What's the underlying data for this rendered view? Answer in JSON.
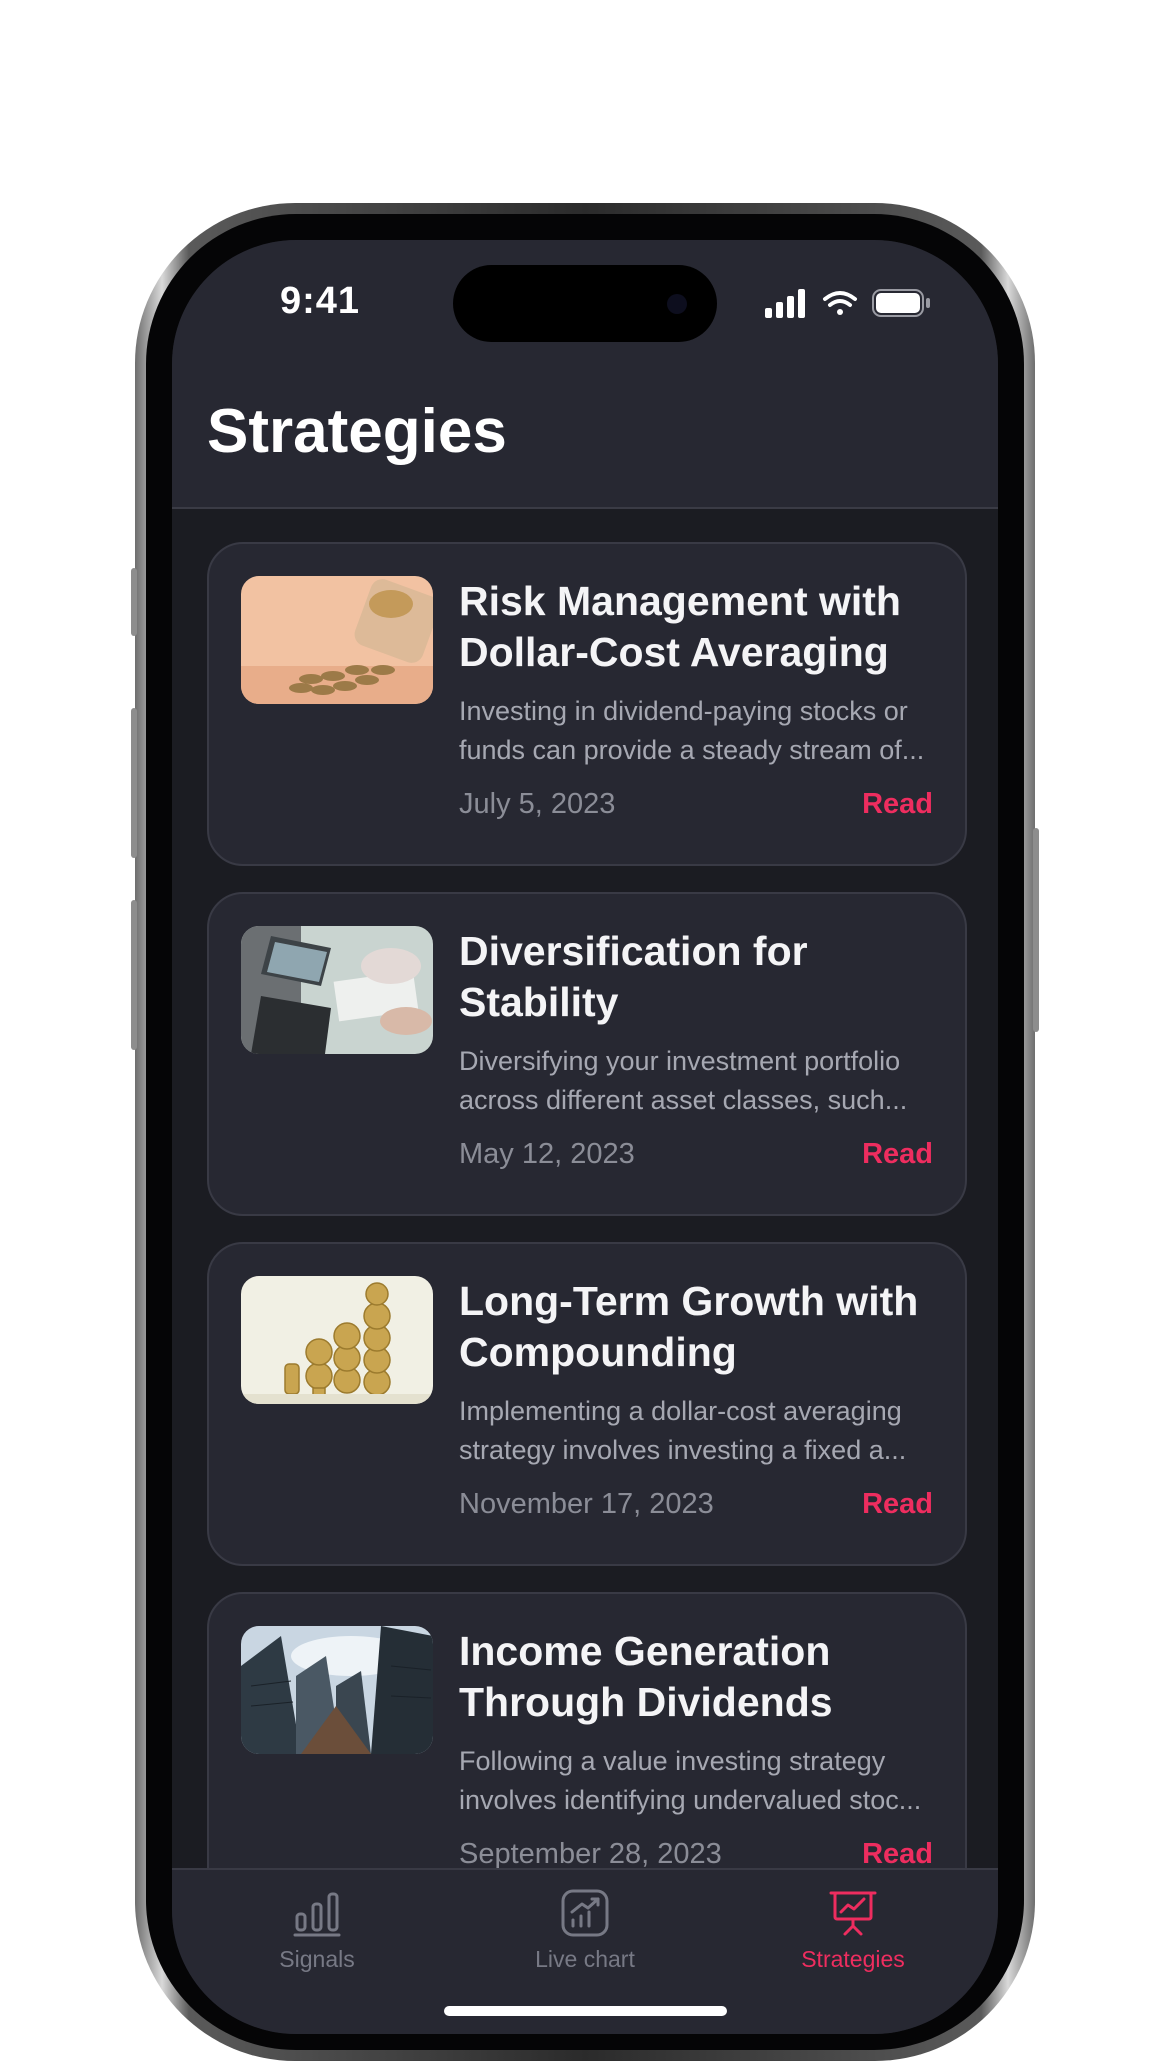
{
  "status_bar": {
    "time": "9:41"
  },
  "header": {
    "title": "Strategies"
  },
  "articles": [
    {
      "title": "Risk Management with Dollar-Cost Averaging",
      "description": "Investing in dividend-paying stocks or funds can provide a steady stream of...",
      "date": "July 5, 2023",
      "action": "Read",
      "image": "coins-jar-image"
    },
    {
      "title": "Diversification for Stability",
      "description": "Diversifying your investment portfolio across different asset classes, such...",
      "date": "May 12, 2023",
      "action": "Read",
      "image": "laptop-meeting-image"
    },
    {
      "title": "Long-Term Growth with Compounding",
      "description": "Implementing a dollar-cost averaging strategy involves investing a fixed a...",
      "date": "November 17, 2023",
      "action": "Read",
      "image": "coin-stacks-image"
    },
    {
      "title": "Income Generation Through Dividends",
      "description": "Following a value investing strategy involves identifying undervalued stoc...",
      "date": "September 28, 2023",
      "action": "Read",
      "image": "skyscrapers-image"
    }
  ],
  "tabbar": {
    "tabs": [
      {
        "label": "Signals",
        "icon": "bar-chart-icon",
        "active": false
      },
      {
        "label": "Live chart",
        "icon": "trend-chart-icon",
        "active": false
      },
      {
        "label": "Strategies",
        "icon": "presentation-icon",
        "active": true
      }
    ]
  },
  "colors": {
    "accent": "#ee2d5f",
    "background": "#1b1c22",
    "surface": "#272832",
    "border": "#393a45"
  }
}
